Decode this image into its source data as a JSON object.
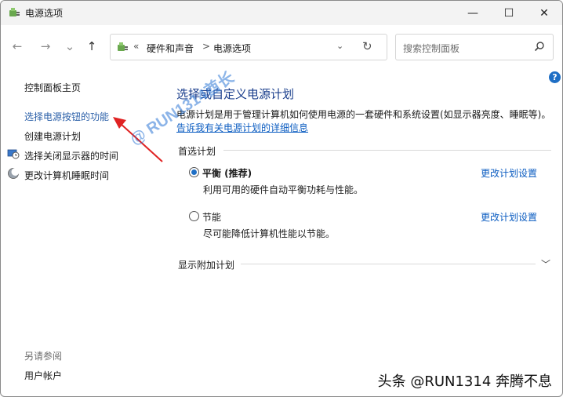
{
  "window": {
    "title": "电源选项",
    "minimize_glyph": "—",
    "maximize_glyph": "☐",
    "close_glyph": "✕"
  },
  "nav": {
    "back_glyph": "←",
    "forward_glyph": "→",
    "recent_glyph": "⌄",
    "up_glyph": "↑"
  },
  "address": {
    "overflow": "«",
    "crumbs": [
      "硬件和声音",
      "电源选项"
    ],
    "separator": ">",
    "dropdown_glyph": "⌄",
    "refresh_glyph": "↻"
  },
  "search": {
    "placeholder": "搜索控制面板"
  },
  "help_label": "?",
  "sidebar": {
    "items": [
      {
        "label": "控制面板主页"
      },
      {
        "label": "选择电源按钮的功能"
      },
      {
        "label": "创建电源计划"
      },
      {
        "label": "选择关闭显示器的时间",
        "icon": "monitor-clock-icon"
      },
      {
        "label": "更改计算机睡眠时间",
        "icon": "moon-icon"
      }
    ],
    "see_also": "另请参阅",
    "user_accounts": "用户帐户"
  },
  "main": {
    "heading": "选择或自定义电源计划",
    "description": "电源计划是用于管理计算机如何使用电源的一套硬件和系统设置(如显示器亮度、睡眠等)。",
    "more_info_link": "告诉我有关电源计划的详细信息",
    "preferred_group_label": "首选计划",
    "plans": [
      {
        "name": "平衡 (推荐)",
        "description": "利用可用的硬件自动平衡功耗与性能。",
        "change_link": "更改计划设置",
        "selected": true
      },
      {
        "name": "节能",
        "description": "尽可能降低计算机性能以节能。",
        "change_link": "更改计划设置",
        "selected": false
      }
    ],
    "show_extra": "显示附加计划"
  },
  "watermark": "@ RUN1314酋长",
  "credit": "头条 @RUN1314 奔腾不息",
  "colors": {
    "accent": "#1f6fc5",
    "link": "#0b5cc1",
    "arrow": "#e02222"
  }
}
